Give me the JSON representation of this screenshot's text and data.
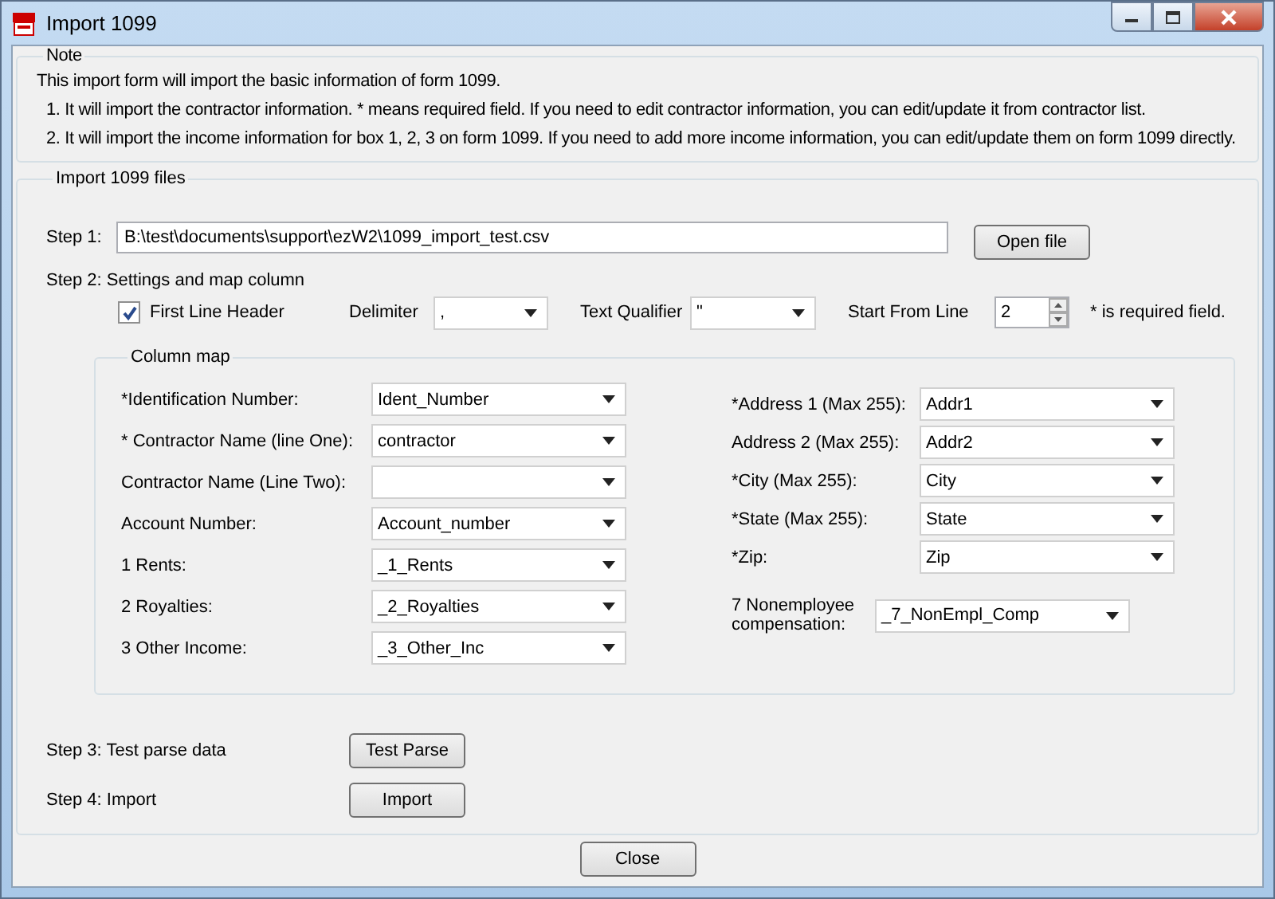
{
  "window": {
    "title": "Import 1099"
  },
  "note": {
    "title": "Note",
    "intro": "This import form will import the basic information of form 1099.",
    "lines": [
      "1. It will import the contractor information. * means required field. If you need to edit contractor information, you can edit/update it from contractor list.",
      "2. It will import the income information for box 1, 2, 3 on form 1099. If you need to add more income information, you can edit/update them on form 1099 directly."
    ]
  },
  "import": {
    "title": "Import 1099 files",
    "step1": {
      "label": "Step 1:",
      "path": "B:\\test\\documents\\support\\ezW2\\1099_import_test.csv",
      "button": "Open file"
    },
    "step2": {
      "label": "Step 2:  Settings and map column",
      "first_line_header": {
        "label": "First Line Header",
        "checked": true
      },
      "delimiter": {
        "label": "Delimiter",
        "value": ","
      },
      "text_qualifier": {
        "label": "Text Qualifier",
        "value": "\""
      },
      "start_from_line": {
        "label": "Start From Line",
        "value": "2"
      },
      "required_note": "* is required field."
    },
    "column_map": {
      "title": "Column map",
      "left": [
        {
          "label": "*Identification Number:",
          "value": "Ident_Number"
        },
        {
          "label": "* Contractor Name (line One):",
          "value": "contractor"
        },
        {
          "label": "Contractor Name (Line Two):"
        },
        {
          "label": "Account Number:",
          "value": "Account_number"
        },
        {
          "label": "1 Rents:",
          "value": "_1_Rents"
        },
        {
          "label": "2 Royalties:",
          "value": "_2_Royalties"
        },
        {
          "label": "3 Other Income:",
          "value": "_3_Other_Inc"
        }
      ],
      "right": [
        {
          "label": "*Address 1 (Max 255):",
          "value": "Addr1"
        },
        {
          "label": "Address 2 (Max 255):",
          "value": "Addr2"
        },
        {
          "label": "*City (Max 255):",
          "value": "City"
        },
        {
          "label": "*State (Max 255):",
          "value": "State"
        },
        {
          "label": "*Zip:",
          "value": "Zip"
        },
        {
          "label": "7 Nonemployee compensation:",
          "value": "_7_NonEmpl_Comp"
        }
      ]
    }
  },
  "step3": {
    "label": "Step 3: Test parse data",
    "button": "Test Parse"
  },
  "step4": {
    "label": "Step 4: Import",
    "button": "Import"
  },
  "close_button": "Close"
}
